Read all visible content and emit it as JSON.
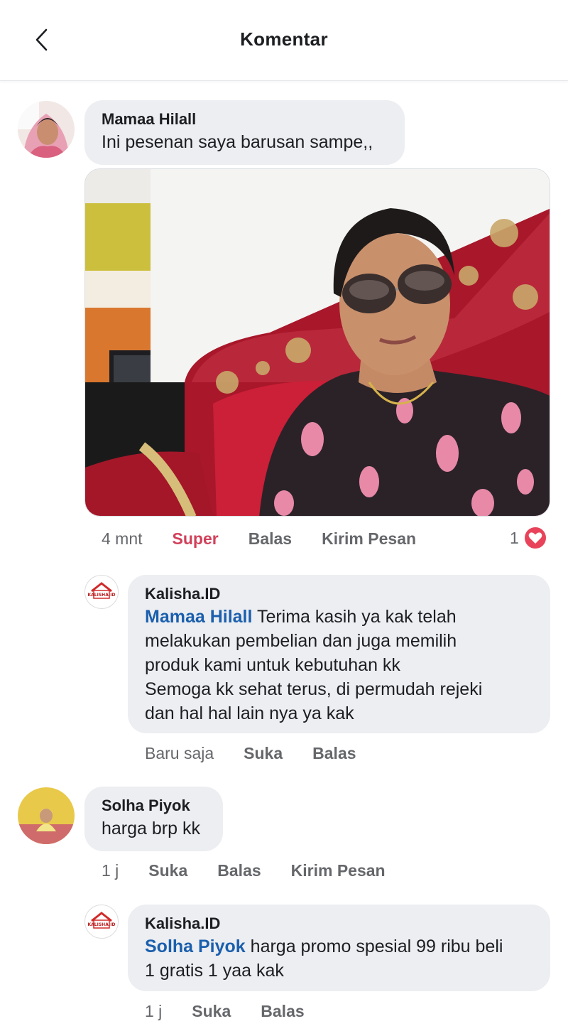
{
  "header": {
    "title": "Komentar",
    "back_icon": "chevron-left-icon"
  },
  "comments": [
    {
      "author": "Mamaa Hilall",
      "text": "Ini pesenan saya barusan sampe,,",
      "time": "4 mnt",
      "reaction_label": "Super",
      "reply_label": "Balas",
      "message_label": "Kirim Pesan",
      "reaction_count": "1",
      "reaction_icon": "heart-icon",
      "reply": {
        "author": "Kalisha.ID",
        "mention": "Mamaa Hilall",
        "lines": [
          " Terima kasih ya kak telah",
          "melakukan pembelian dan juga memilih",
          "produk kami untuk kebutuhan kk",
          "Semoga kk sehat terus, di permudah rejeki",
          "dan hal hal lain nya ya kak"
        ],
        "time": "Baru saja",
        "like_label": "Suka",
        "reply_label": "Balas",
        "logo_text": "KALISHA.ID"
      }
    },
    {
      "author": "Solha Piyok",
      "text": "harga brp kk",
      "time": "1 j",
      "like_label": "Suka",
      "reply_label": "Balas",
      "message_label": "Kirim Pesan",
      "reply": {
        "author": "Kalisha.ID",
        "mention": "Solha Piyok",
        "lines": [
          " harga promo spesial 99 ribu beli",
          "1 gratis 1 yaa kak"
        ],
        "time": "1 j",
        "like_label": "Suka",
        "reply_label": "Balas",
        "logo_text": "KALISHA.ID"
      }
    }
  ],
  "colors": {
    "accent_mention": "#1b5fad",
    "super_reaction": "#d1405a",
    "bubble_bg": "#eceef1",
    "heart": "#e8435a"
  }
}
